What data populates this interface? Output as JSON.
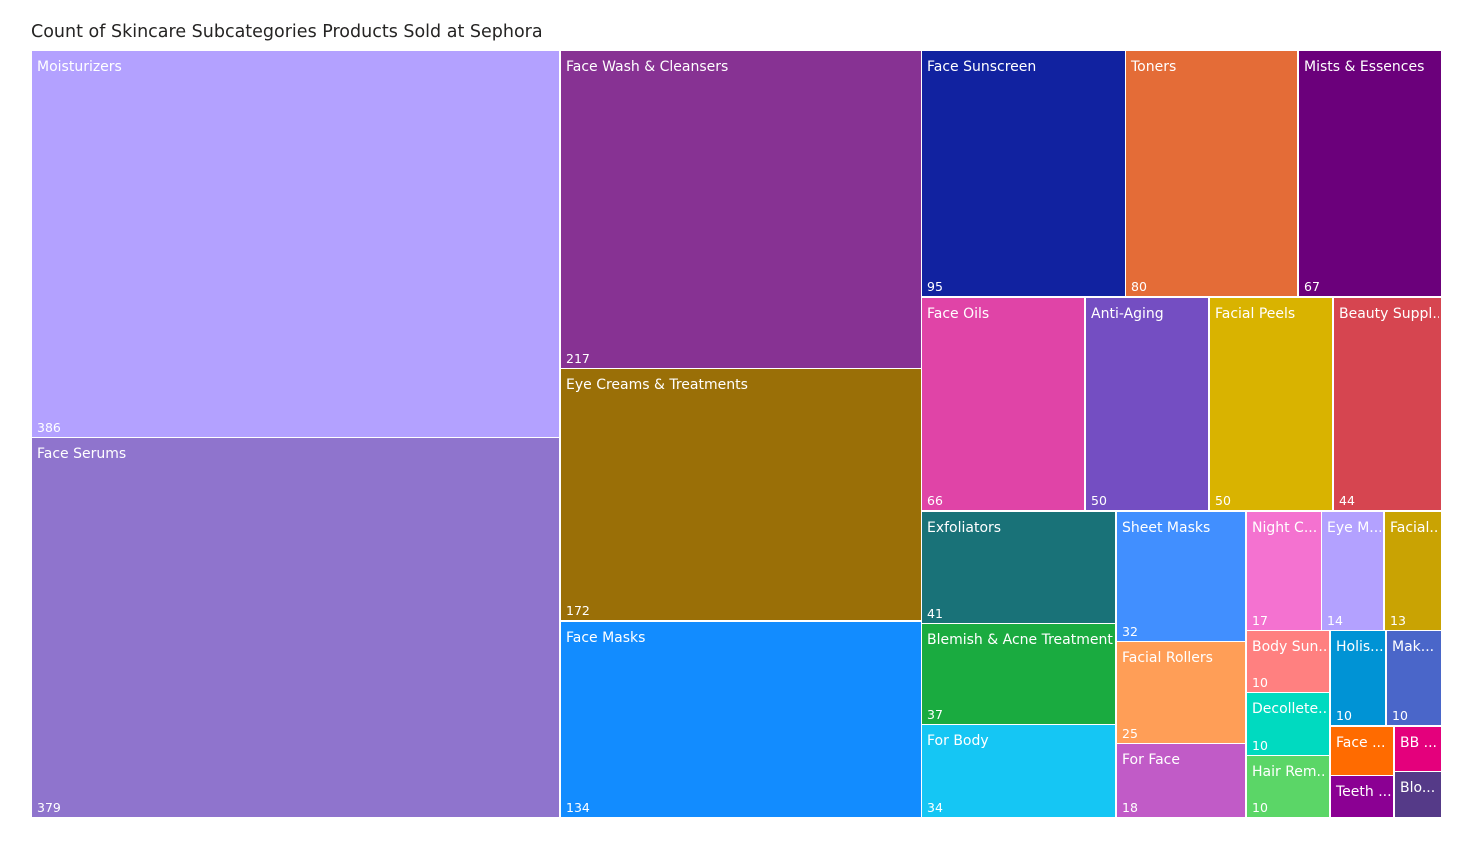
{
  "chart_data": {
    "type": "treemap",
    "title": "Count of Skincare Subcategories Products Sold at Sephora",
    "items": [
      {
        "name": "Moisturizers",
        "label": "Moisturizers",
        "value": 386,
        "color": "#B3A1FF"
      },
      {
        "name": "Face Serums",
        "label": "Face Serums",
        "value": 379,
        "color": "#8F74CD"
      },
      {
        "name": "Face Wash & Cleansers",
        "label": "Face Wash & Cleansers",
        "value": 217,
        "color": "#873293"
      },
      {
        "name": "Eye Creams & Treatments",
        "label": "Eye Creams & Treatments",
        "value": 172,
        "color": "#9A6F07"
      },
      {
        "name": "Face Masks",
        "label": "Face Masks",
        "value": 134,
        "color": "#128CFF"
      },
      {
        "name": "Face Sunscreen",
        "label": "Face Sunscreen",
        "value": 95,
        "color": "#1122A0"
      },
      {
        "name": "Toners",
        "label": "Toners",
        "value": 80,
        "color": "#E46C37"
      },
      {
        "name": "Mists & Essences",
        "label": "Mists & Essences",
        "value": 67,
        "color": "#6B007B"
      },
      {
        "name": "Face Oils",
        "label": "Face Oils",
        "value": 66,
        "color": "#E044A7"
      },
      {
        "name": "Anti-Aging",
        "label": "Anti-Aging",
        "value": 50,
        "color": "#744EC2"
      },
      {
        "name": "Facial Peels",
        "label": "Facial Peels",
        "value": 50,
        "color": "#D9B300"
      },
      {
        "name": "Beauty Suppl...",
        "label": "Beauty Suppl...",
        "value": 44,
        "color": "#D64550"
      },
      {
        "name": "Exfoliators",
        "label": "Exfoliators",
        "value": 41,
        "color": "#197278"
      },
      {
        "name": "Sheet Masks",
        "label": "Sheet Masks",
        "value": 32,
        "color": "#418FFF"
      },
      {
        "name": "Night C...",
        "label": "Night C...",
        "value": 17,
        "color": "#F472D0"
      },
      {
        "name": "Eye M...",
        "label": "Eye M...",
        "value": 14,
        "color": "#B3A1FF"
      },
      {
        "name": "Facial...",
        "label": "Facial...",
        "value": 13,
        "color": "#C9A303"
      },
      {
        "name": "Blemish & Acne Treatments",
        "label": "Blemish & Acne Treatments",
        "value": 37,
        "color": "#1AAB40"
      },
      {
        "name": "Facial Rollers",
        "label": "Facial Rollers",
        "value": 25,
        "color": "#FF9E57"
      },
      {
        "name": "Body Sun...",
        "label": "Body Sun...",
        "value": 10,
        "color": "#FF8080"
      },
      {
        "name": "Holis...",
        "label": "Holis...",
        "value": 10,
        "color": "#0093D5"
      },
      {
        "name": "Mak...",
        "label": "Mak...",
        "value": 10,
        "color": "#4A66C9"
      },
      {
        "name": "Decollete...",
        "label": "Decollete...",
        "value": 10,
        "color": "#00DAC0"
      },
      {
        "name": "For Body",
        "label": "For Body",
        "value": 34,
        "color": "#15C6F4"
      },
      {
        "name": "For Face",
        "label": "For Face",
        "value": 18,
        "color": "#C15BC7"
      },
      {
        "name": "Face ...",
        "label": "Face ...",
        "value": null,
        "color": "#FF6B00"
      },
      {
        "name": "BB ...",
        "label": "BB ...",
        "value": null,
        "color": "#E4007C"
      },
      {
        "name": "Hair Rem...",
        "label": "Hair Rem...",
        "value": 10,
        "color": "#5BD667"
      },
      {
        "name": "Teeth ...",
        "label": "Teeth ...",
        "value": null,
        "color": "#8B0093"
      },
      {
        "name": "Blo...",
        "label": "Blo...",
        "value": null,
        "color": "#553A88"
      }
    ]
  }
}
